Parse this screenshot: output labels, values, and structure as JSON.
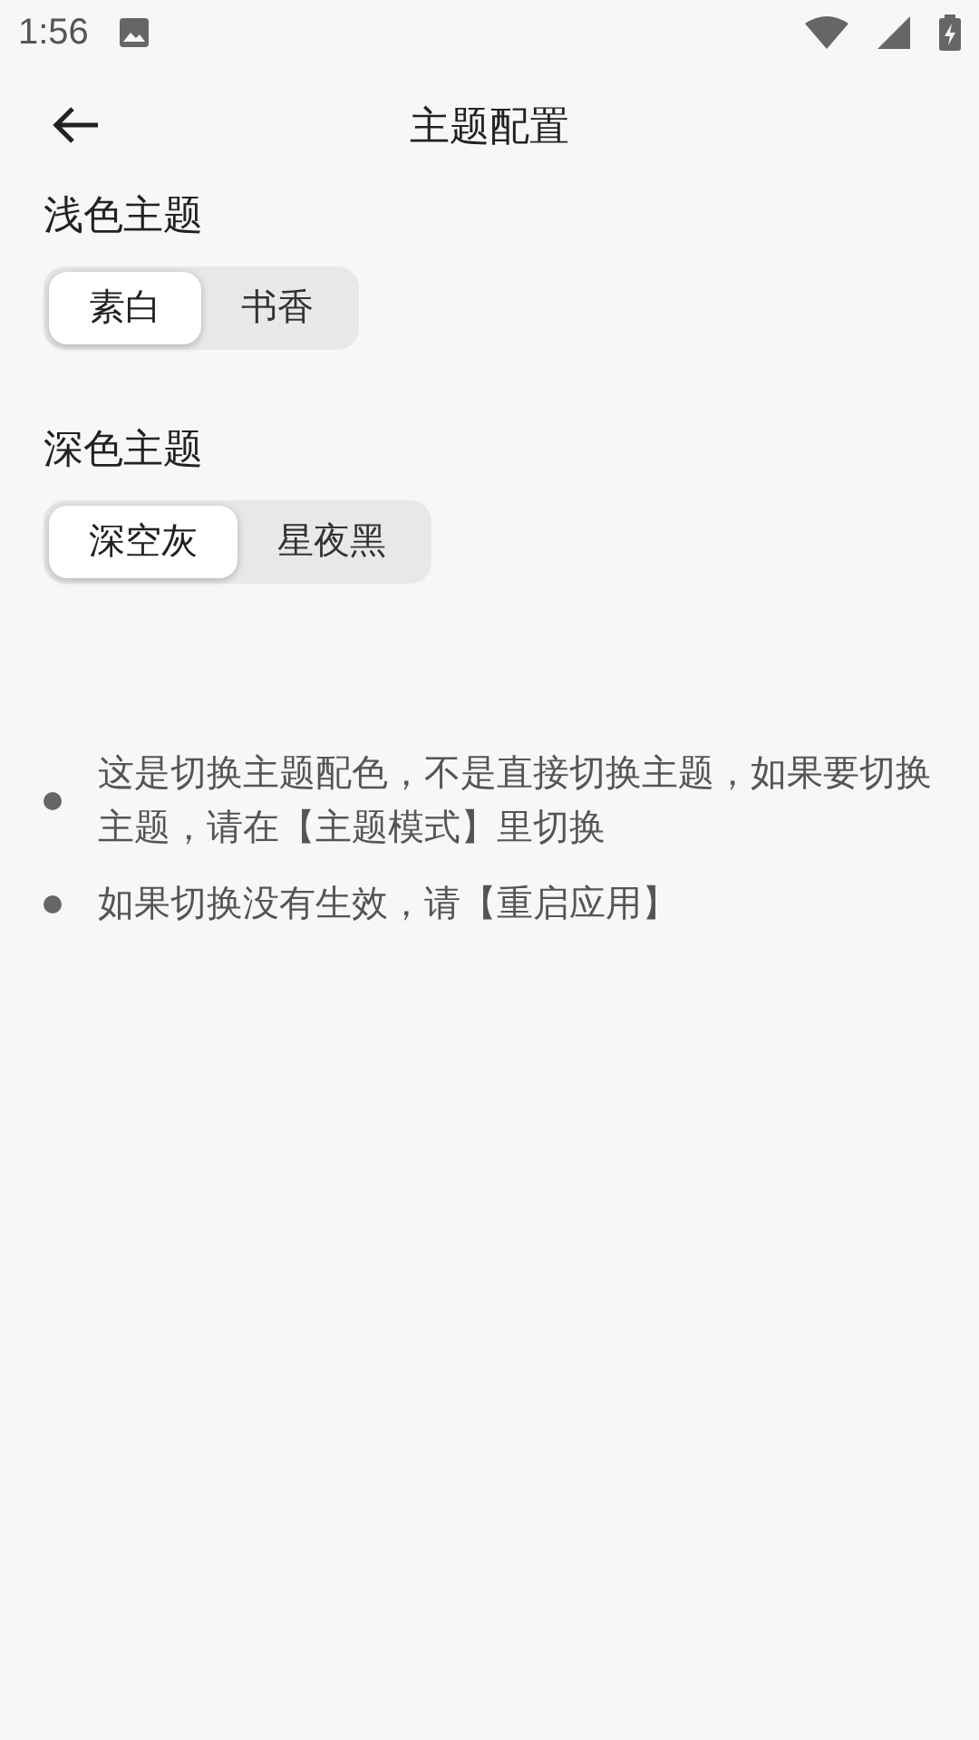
{
  "status_bar": {
    "time": "1:56"
  },
  "app_bar": {
    "title": "主题配置"
  },
  "sections": [
    {
      "title": "浅色主题",
      "options": [
        {
          "label": "素白",
          "selected": true
        },
        {
          "label": "书香",
          "selected": false
        }
      ]
    },
    {
      "title": "深色主题",
      "options": [
        {
          "label": "深空灰",
          "selected": true
        },
        {
          "label": "星夜黑",
          "selected": false
        }
      ]
    }
  ],
  "notes": [
    "这是切换主题配色，不是直接切换主题，如果要切换主题，请在【主题模式】里切换",
    "如果切换没有生效，请【重启应用】"
  ]
}
